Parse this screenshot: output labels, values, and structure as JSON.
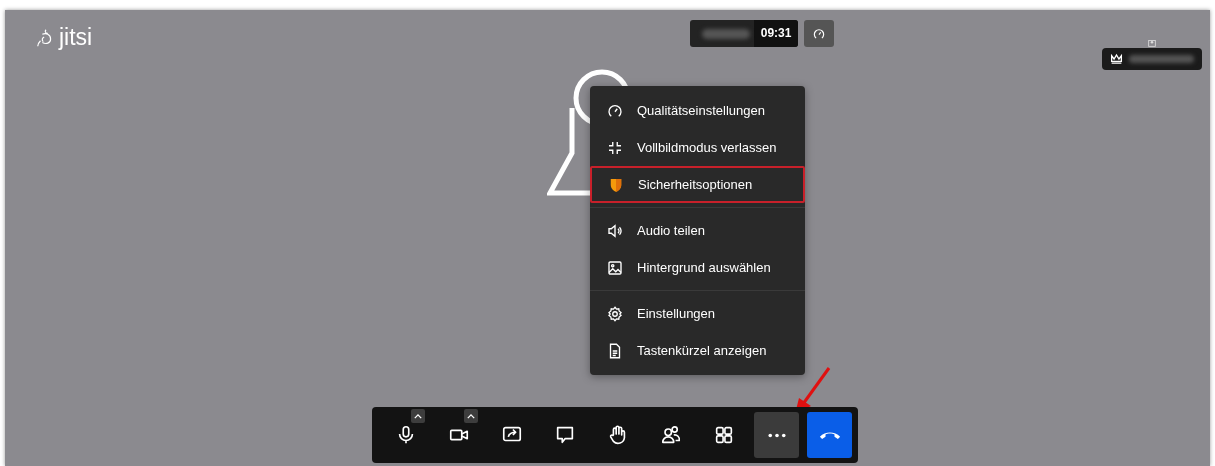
{
  "logo": {
    "text": "jitsi"
  },
  "header": {
    "timer": "09:31"
  },
  "menu": {
    "groups": [
      [
        {
          "label": "Qualitätseinstellungen",
          "kind": "gauge",
          "highlighted": false
        },
        {
          "label": "Vollbildmodus verlassen",
          "kind": "exit-fullscreen",
          "highlighted": false
        },
        {
          "label": "Sicherheitsoptionen",
          "kind": "shield",
          "highlighted": true
        }
      ],
      [
        {
          "label": "Audio teilen",
          "kind": "speaker",
          "highlighted": false
        },
        {
          "label": "Hintergrund auswählen",
          "kind": "image",
          "highlighted": false
        }
      ],
      [
        {
          "label": "Einstellungen",
          "kind": "gear",
          "highlighted": false
        },
        {
          "label": "Tastenkürzel anzeigen",
          "kind": "document",
          "highlighted": false
        }
      ]
    ]
  },
  "toolbar": {
    "buttons": [
      {
        "kind": "microphone",
        "has_options": true,
        "selected": false
      },
      {
        "kind": "camera",
        "has_options": true,
        "selected": false
      },
      {
        "kind": "screen-share",
        "has_options": false,
        "selected": false
      },
      {
        "kind": "chat",
        "has_options": false,
        "selected": false
      },
      {
        "kind": "raise-hand",
        "has_options": false,
        "selected": false
      },
      {
        "kind": "participants",
        "has_options": false,
        "selected": false
      },
      {
        "kind": "tile-view",
        "has_options": false,
        "selected": false
      },
      {
        "kind": "more",
        "has_options": false,
        "selected": true
      },
      {
        "kind": "hangup",
        "has_options": false,
        "selected": false
      }
    ]
  }
}
